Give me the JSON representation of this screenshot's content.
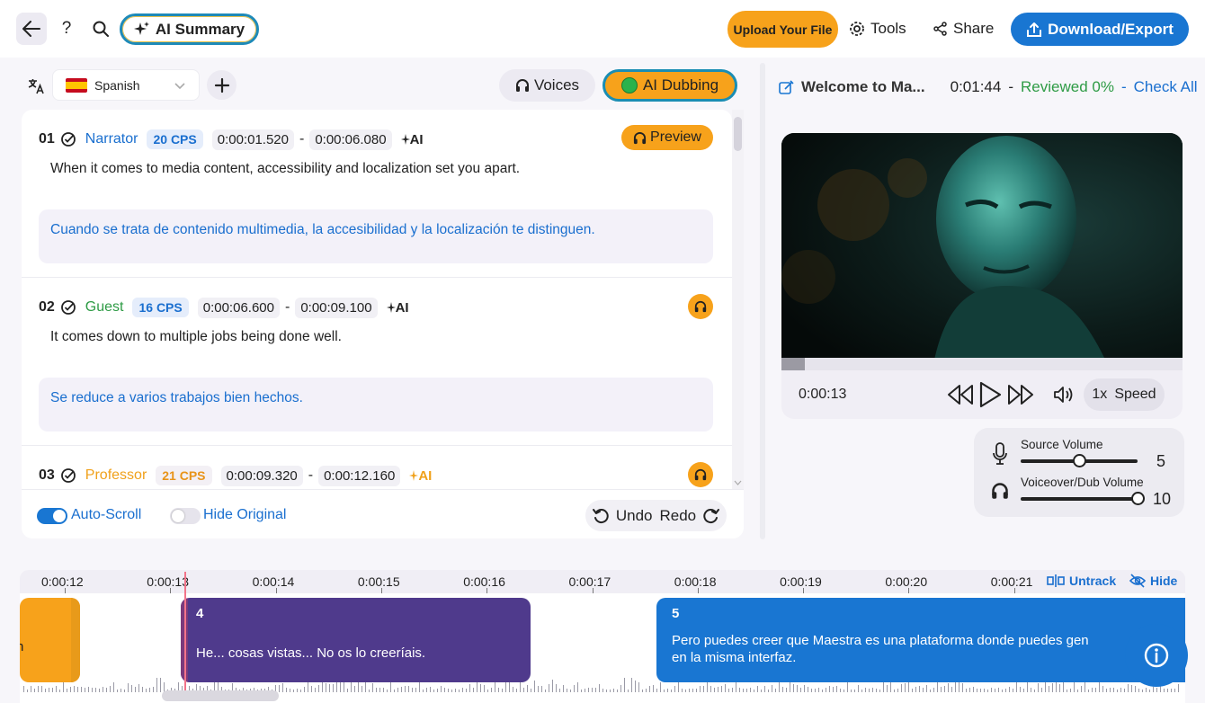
{
  "header": {
    "ai_summary": "AI Summary",
    "help": "?",
    "upload": "Upload Your File",
    "tools": "Tools",
    "share": "Share",
    "download": "Download/Export"
  },
  "editor": {
    "language": "Spanish",
    "voices": "Voices",
    "ai_dubbing": "AI Dubbing",
    "preview": "Preview",
    "ai_tag": "AI",
    "segments": [
      {
        "num": "01",
        "speaker": "Narrator",
        "speaker_color": "#1a6fcf",
        "cps": "20 CPS",
        "cps_color": "#1a6fcf",
        "cps_bg": "#e5edfb",
        "start": "0:00:01.520",
        "end": "0:00:06.080",
        "ai_color": "#222222",
        "original": "When it comes to media content, accessibility and localization set you apart.",
        "translation": "Cuando se trata de contenido multimedia, la accesibilidad y la localización te distinguen."
      },
      {
        "num": "02",
        "speaker": "Guest",
        "speaker_color": "#2e9b45",
        "cps": "16 CPS",
        "cps_color": "#1a6fcf",
        "cps_bg": "#e5edfb",
        "start": "0:00:06.600",
        "end": "0:00:09.100",
        "ai_color": "#222222",
        "original": "It comes down to multiple jobs being done well.",
        "translation": "Se reduce a varios trabajos bien hechos."
      },
      {
        "num": "03",
        "speaker": "Professor",
        "speaker_color": "#f0a11b",
        "cps": "21 CPS",
        "cps_color": "#e8941a",
        "cps_bg": "#f3f0f5",
        "start": "0:00:09.320",
        "end": "0:00:12.160",
        "ai_color": "#f0a11b"
      }
    ],
    "auto_scroll": "Auto-Scroll",
    "hide_original": "Hide Original",
    "undo": "Undo",
    "redo": "Redo"
  },
  "player": {
    "title": "Welcome to Ma...",
    "duration": "0:01:44",
    "reviewed": "Reviewed 0%",
    "check_all": "Check All",
    "current_time": "0:00:13",
    "progress": 0.13,
    "speed_value": "1x",
    "speed_label": "Speed"
  },
  "volume": {
    "source_label": "Source Volume",
    "source_value": "5",
    "source_level": 0.5,
    "dub_label": "Voiceover/Dub Volume",
    "dub_value": "10",
    "dub_level": 1.0
  },
  "timeline": {
    "ticks": [
      "0:00:12",
      "0:00:13",
      "0:00:14",
      "0:00:15",
      "0:00:16",
      "0:00:17",
      "0:00:18",
      "0:00:19",
      "0:00:20",
      "0:00:21"
    ],
    "untrack": "Untrack",
    "hide": "Hide",
    "blocks": [
      {
        "num": "",
        "text": "n",
        "color": "#f7a21b"
      },
      {
        "num": "4",
        "text": "He... cosas vistas... No os lo creeríais.",
        "color": "#4f3a8c"
      },
      {
        "num": "5",
        "text": "Pero puedes creer que Maestra es una plataforma donde puedes gen",
        "text2": "en la misma interfaz.",
        "color": "#1976d2"
      }
    ]
  },
  "colors": {
    "accent": "#1976d2",
    "orange": "#f7a21b",
    "green": "#2e9b45"
  }
}
